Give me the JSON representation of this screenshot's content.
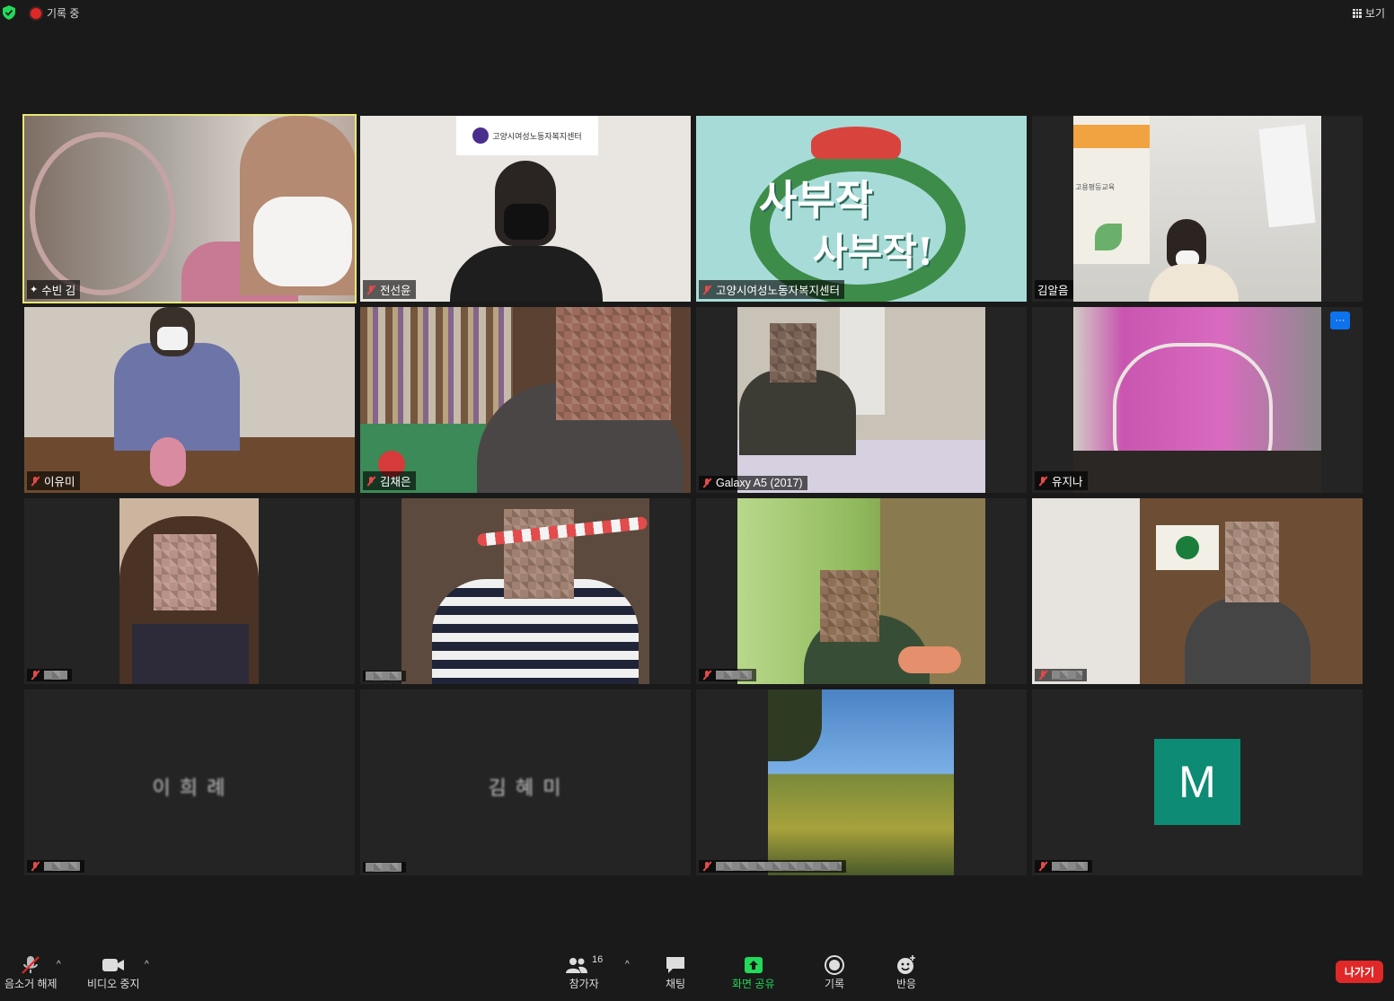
{
  "topbar": {
    "recording_label": "기록 중",
    "view_label": "보기"
  },
  "tiles": [
    {
      "name": "수빈 김"
    },
    {
      "name": "전선윤",
      "banner": "고양시여성노동자복지센터"
    },
    {
      "name": "고양시여성노동자복지센터",
      "art_text_1": "사부작",
      "art_text_2": "사부작!"
    },
    {
      "name": "김알음",
      "poster": "고용평등교육"
    },
    {
      "name": "이유미"
    },
    {
      "name": "김채은"
    },
    {
      "name": "Galaxy A5 (2017)"
    },
    {
      "name": "유지나",
      "more": "···"
    },
    {
      "name": ""
    },
    {
      "name": ""
    },
    {
      "name": ""
    },
    {
      "name": ""
    },
    {
      "name": "",
      "center": "이 희 례"
    },
    {
      "name": "",
      "center": "김 혜 미"
    },
    {
      "name": ""
    },
    {
      "name": "",
      "avatar": "M"
    }
  ],
  "toolbar": {
    "unmute_label": "음소거 해제",
    "stop_video_label": "비디오 중지",
    "participants_label": "참가자",
    "participants_count": "16",
    "chat_label": "채팅",
    "share_label": "화면 공유",
    "record_label": "기록",
    "reactions_label": "반응",
    "leave_label": "나가기"
  },
  "colors": {
    "accent_active": "#e7e776",
    "leave": "#e02828",
    "share_green": "#23d959",
    "avatar_bg": "#0d8b74",
    "more_blue": "#0e72ed"
  }
}
